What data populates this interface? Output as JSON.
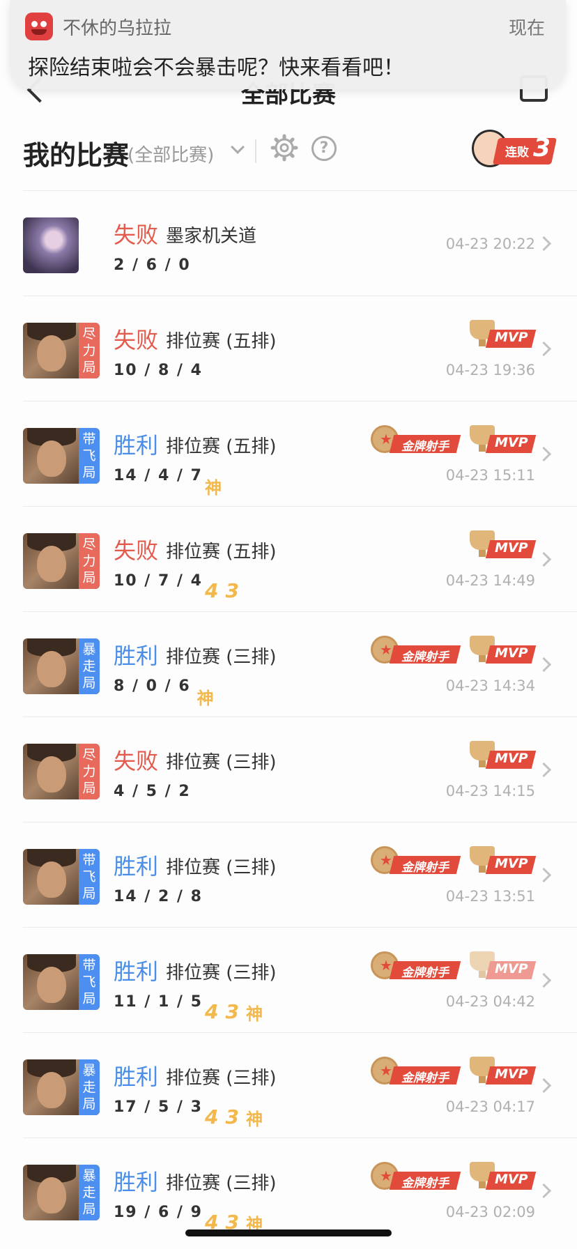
{
  "notification": {
    "app_name": "不休的乌拉拉",
    "time": "现在",
    "message": "探险结束啦会不会暴击呢？快来看看吧！"
  },
  "nav": {
    "title": "全部比赛"
  },
  "header": {
    "title": "我的比赛",
    "filter": "(全部比赛)",
    "streak_label": "连败",
    "streak_count": "3"
  },
  "colors": {
    "lose": "#e45a4c",
    "win": "#4a8ee8",
    "badge_gold": "#f2b84b",
    "mvp_red": "#e24b3b"
  },
  "matches": [
    {
      "result": "失败",
      "mode": "墨家机关道",
      "kda": "2 / 6 / 0",
      "tag": "",
      "badges": [],
      "time": "04-23 20:22",
      "mvp": false,
      "gold": false
    },
    {
      "result": "失败",
      "mode": "排位赛 (五排)",
      "kda": "10 / 8 / 4",
      "tag": "尽力局",
      "badges": [],
      "time": "04-23 19:36",
      "mvp": true,
      "gold": false
    },
    {
      "result": "胜利",
      "mode": "排位赛 (五排)",
      "kda": "14 / 4 / 7",
      "tag": "带飞局",
      "badges": [
        "神"
      ],
      "time": "04-23 15:11",
      "mvp": true,
      "gold": true
    },
    {
      "result": "失败",
      "mode": "排位赛 (五排)",
      "kda": "10 / 7 / 4",
      "tag": "尽力局",
      "badges": [
        "4",
        "3"
      ],
      "time": "04-23 14:49",
      "mvp": true,
      "gold": false
    },
    {
      "result": "胜利",
      "mode": "排位赛 (三排)",
      "kda": "8 / 0 / 6",
      "tag": "暴走局",
      "badges": [
        "神"
      ],
      "time": "04-23 14:34",
      "mvp": true,
      "gold": true
    },
    {
      "result": "失败",
      "mode": "排位赛 (三排)",
      "kda": "4 / 5 / 2",
      "tag": "尽力局",
      "badges": [],
      "time": "04-23 14:15",
      "mvp": true,
      "gold": false
    },
    {
      "result": "胜利",
      "mode": "排位赛 (三排)",
      "kda": "14 / 2 / 8",
      "tag": "带飞局",
      "badges": [],
      "time": "04-23 13:51",
      "mvp": true,
      "gold": true
    },
    {
      "result": "胜利",
      "mode": "排位赛 (三排)",
      "kda": "11 / 1 / 5",
      "tag": "带飞局",
      "badges": [
        "4",
        "3",
        "神"
      ],
      "time": "04-23 04:42",
      "mvp": true,
      "mvp_faded": true,
      "gold": true
    },
    {
      "result": "胜利",
      "mode": "排位赛 (三排)",
      "kda": "17 / 5 / 3",
      "tag": "暴走局",
      "badges": [
        "4",
        "3",
        "神"
      ],
      "time": "04-23 04:17",
      "mvp": true,
      "gold": true
    },
    {
      "result": "胜利",
      "mode": "排位赛 (三排)",
      "kda": "19 / 6 / 9",
      "tag": "暴走局",
      "badges": [
        "4",
        "3",
        "神"
      ],
      "time": "04-23 02:09",
      "mvp": true,
      "gold": true
    }
  ],
  "labels": {
    "mvp": "MVP",
    "gold": "金牌射手"
  }
}
